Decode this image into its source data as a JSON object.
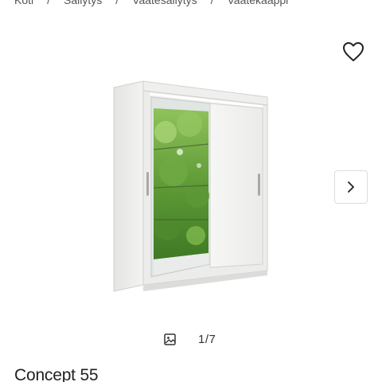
{
  "breadcrumb": {
    "items": [
      "Koti",
      "Säilytys",
      "Vaatesäilytys",
      "Vaatekaappi"
    ],
    "separator": "/"
  },
  "favorite": {
    "icon": "heart-outline-icon"
  },
  "gallery": {
    "current": 1,
    "total": 7,
    "counter_text": "1/7",
    "gallery_icon": "image-gallery-icon",
    "next_icon": "chevron-right-icon"
  },
  "product": {
    "title": "Concept 55",
    "image_subject": "white sliding-door wardrobe with mirror"
  },
  "colors": {
    "text": "#222222",
    "border": "#dcdcdc",
    "wardrobe": "#eeeeec"
  }
}
